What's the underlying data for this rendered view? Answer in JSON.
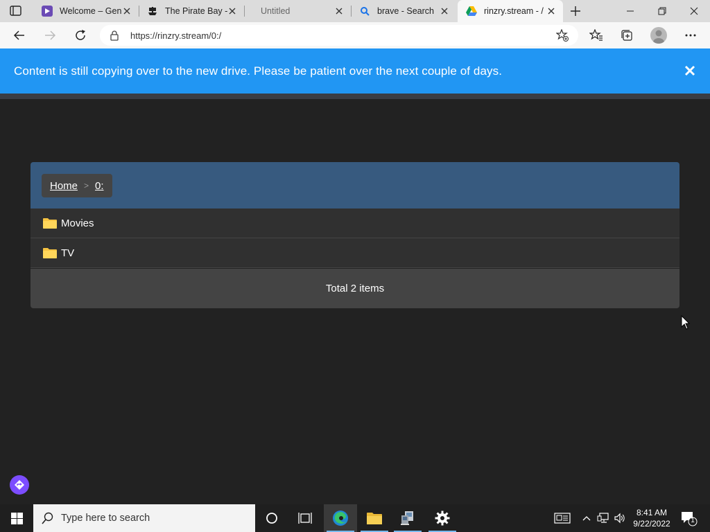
{
  "browser": {
    "tabs": [
      {
        "title": "Welcome – Gen",
        "favicon": "purple-play-icon",
        "active": false
      },
      {
        "title": "The Pirate Bay -",
        "favicon": "pirate-ship-icon",
        "active": false
      },
      {
        "title": "Untitled",
        "favicon": "",
        "active": false
      },
      {
        "title": "brave - Search",
        "favicon": "magnifier-icon",
        "active": false
      },
      {
        "title": "rinzry.stream - /",
        "favicon": "google-drive-icon",
        "active": true
      }
    ],
    "url": "https://rinzry.stream/0:/"
  },
  "notice": {
    "text": "Content is still copying over to the new drive. Please be patient over the next couple of days.",
    "color": "#2196f3"
  },
  "breadcrumb": {
    "home": "Home",
    "separator": ">",
    "current": "0:"
  },
  "listing": {
    "items": [
      {
        "name": "Movies",
        "type": "folder"
      },
      {
        "name": "TV",
        "type": "folder"
      }
    ],
    "total": "Total 2 items"
  },
  "taskbar": {
    "search_placeholder": "Type here to search",
    "time": "8:41 AM",
    "date": "9/22/2022",
    "notification_count": "1"
  },
  "colors": {
    "page_bg": "#222222",
    "breadcrumb_bar": "#375a7f",
    "row_bg": "#303030",
    "accent_purple": "#7c4dff"
  }
}
